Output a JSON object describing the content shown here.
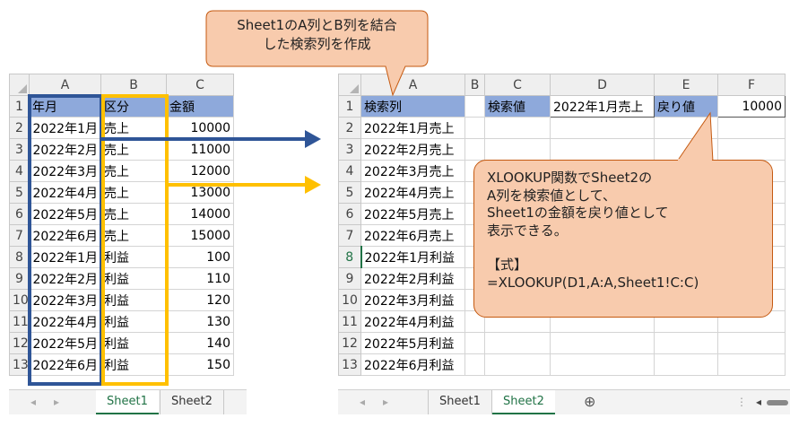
{
  "callout_top": {
    "line1": "Sheet1のA列とB列を結合",
    "line2": "した検索列を作成"
  },
  "callout_right": {
    "line1": "XLOOKUP関数でSheet2の",
    "line2": "A列を検索値として、",
    "line3": "Sheet1の金額を戻り値として",
    "line4": "表示できる。",
    "line5": "【式】",
    "line6": "=XLOOKUP(D1,A:A,Sheet1!C:C)"
  },
  "sheet1": {
    "columns": [
      "A",
      "B",
      "C"
    ],
    "header_row": {
      "row": "1",
      "a": "年月",
      "b": "区分",
      "c": "金額"
    },
    "rows": [
      {
        "row": "2",
        "a": "2022年1月",
        "b": "売上",
        "c": "10000"
      },
      {
        "row": "3",
        "a": "2022年2月",
        "b": "売上",
        "c": "11000"
      },
      {
        "row": "4",
        "a": "2022年3月",
        "b": "売上",
        "c": "12000"
      },
      {
        "row": "5",
        "a": "2022年4月",
        "b": "売上",
        "c": "13000"
      },
      {
        "row": "6",
        "a": "2022年5月",
        "b": "売上",
        "c": "14000"
      },
      {
        "row": "7",
        "a": "2022年6月",
        "b": "売上",
        "c": "15000"
      },
      {
        "row": "8",
        "a": "2022年1月",
        "b": "利益",
        "c": "100"
      },
      {
        "row": "9",
        "a": "2022年2月",
        "b": "利益",
        "c": "110"
      },
      {
        "row": "10",
        "a": "2022年3月",
        "b": "利益",
        "c": "120"
      },
      {
        "row": "11",
        "a": "2022年4月",
        "b": "利益",
        "c": "130"
      },
      {
        "row": "12",
        "a": "2022年5月",
        "b": "利益",
        "c": "140"
      },
      {
        "row": "13",
        "a": "2022年6月",
        "b": "利益",
        "c": "150"
      }
    ],
    "tabs": [
      "Sheet1",
      "Sheet2"
    ]
  },
  "sheet2": {
    "columns": [
      "A",
      "B",
      "C",
      "D",
      "E",
      "F"
    ],
    "row1": {
      "row": "1",
      "a": "検索列",
      "c": "検索値",
      "d": "2022年1月売上",
      "e": "戻り値",
      "f": "10000"
    },
    "rows": [
      {
        "row": "2",
        "a": "2022年1月売上"
      },
      {
        "row": "3",
        "a": "2022年2月売上"
      },
      {
        "row": "4",
        "a": "2022年3月売上"
      },
      {
        "row": "5",
        "a": "2022年4月売上"
      },
      {
        "row": "6",
        "a": "2022年5月売上"
      },
      {
        "row": "7",
        "a": "2022年6月売上"
      },
      {
        "row": "8",
        "a": "2022年1月利益"
      },
      {
        "row": "9",
        "a": "2022年2月利益"
      },
      {
        "row": "10",
        "a": "2022年3月利益"
      },
      {
        "row": "11",
        "a": "2022年4月利益"
      },
      {
        "row": "12",
        "a": "2022年5月利益"
      },
      {
        "row": "13",
        "a": "2022年6月利益"
      }
    ],
    "tabs": [
      "Sheet1",
      "Sheet2"
    ],
    "add_sheet_glyph": "⊕"
  },
  "colors": {
    "navy_highlight": "#2f5597",
    "gold_highlight": "#ffc000",
    "header_fill": "#8ea9db",
    "callout_fill": "#f8cbad",
    "excel_green": "#217346"
  }
}
